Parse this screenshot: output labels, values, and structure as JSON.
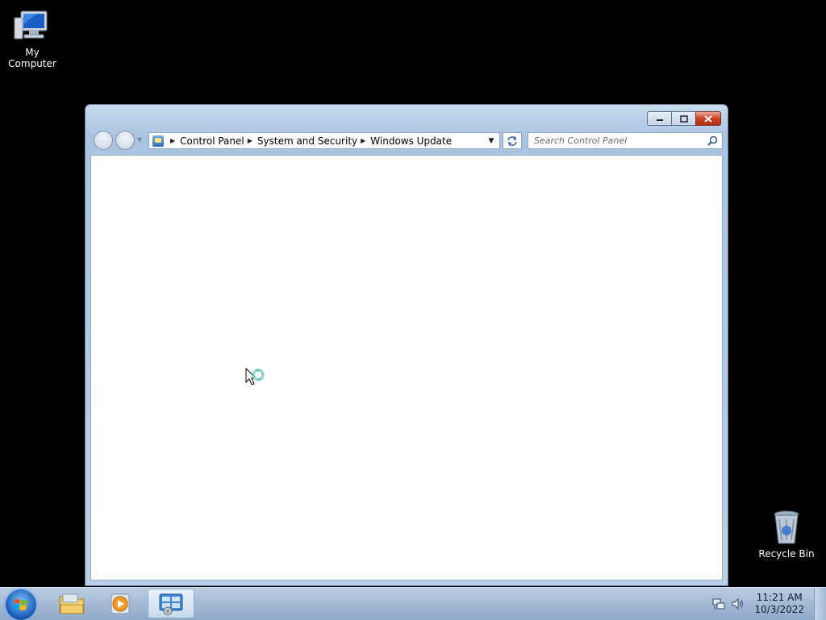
{
  "desktop": {
    "icons": [
      {
        "label": "My Computer",
        "icon": "computer-icon"
      },
      {
        "label": "Recycle Bin",
        "icon": "recycle-bin-icon"
      }
    ]
  },
  "window": {
    "caption_buttons": {
      "minimize": "minimize-icon",
      "maximize": "maximize-icon",
      "close": "close-icon"
    },
    "address": {
      "breadcrumbs": [
        "Control Panel",
        "System and Security",
        "Windows Update"
      ]
    },
    "search": {
      "placeholder": "Search Control Panel"
    }
  },
  "taskbar": {
    "items": [
      {
        "icon": "start-orb-icon"
      },
      {
        "icon": "file-explorer-icon"
      },
      {
        "icon": "media-player-icon"
      },
      {
        "icon": "control-panel-icon",
        "active": true
      }
    ],
    "tray": {
      "time": "11:21 AM",
      "date": "10/3/2022"
    }
  },
  "colors": {
    "desktop_bg": "#000000",
    "window_frame": "#b8cfe9",
    "close_button": "#c7432a",
    "taskbar": "#a9bfd9"
  }
}
